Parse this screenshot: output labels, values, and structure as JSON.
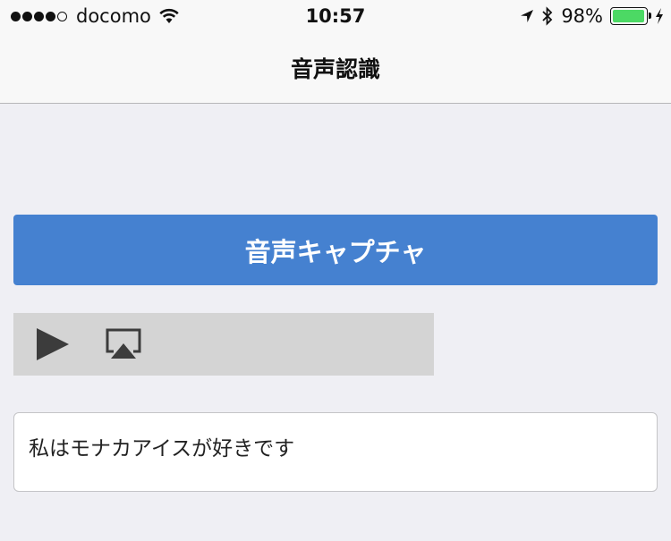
{
  "status_bar": {
    "signal_bars_filled": 4,
    "signal_bars_total": 5,
    "carrier": "docomo",
    "time": "10:57",
    "battery_percent": "98%",
    "battery_level": 0.98,
    "icons": [
      "wifi-icon",
      "location-arrow-icon",
      "bluetooth-icon",
      "battery-icon",
      "charging-bolt-icon"
    ]
  },
  "nav": {
    "title": "音声認識"
  },
  "capture_button": {
    "label": "音声キャプチャ"
  },
  "player": {
    "icons": [
      "play-icon",
      "airplay-icon"
    ]
  },
  "result": {
    "text": "私はモナカアイスが好きです"
  },
  "colors": {
    "button": "#4581d0",
    "player_bg": "#d4d4d4",
    "page_bg": "#efeff4",
    "battery": "#4cd964"
  }
}
